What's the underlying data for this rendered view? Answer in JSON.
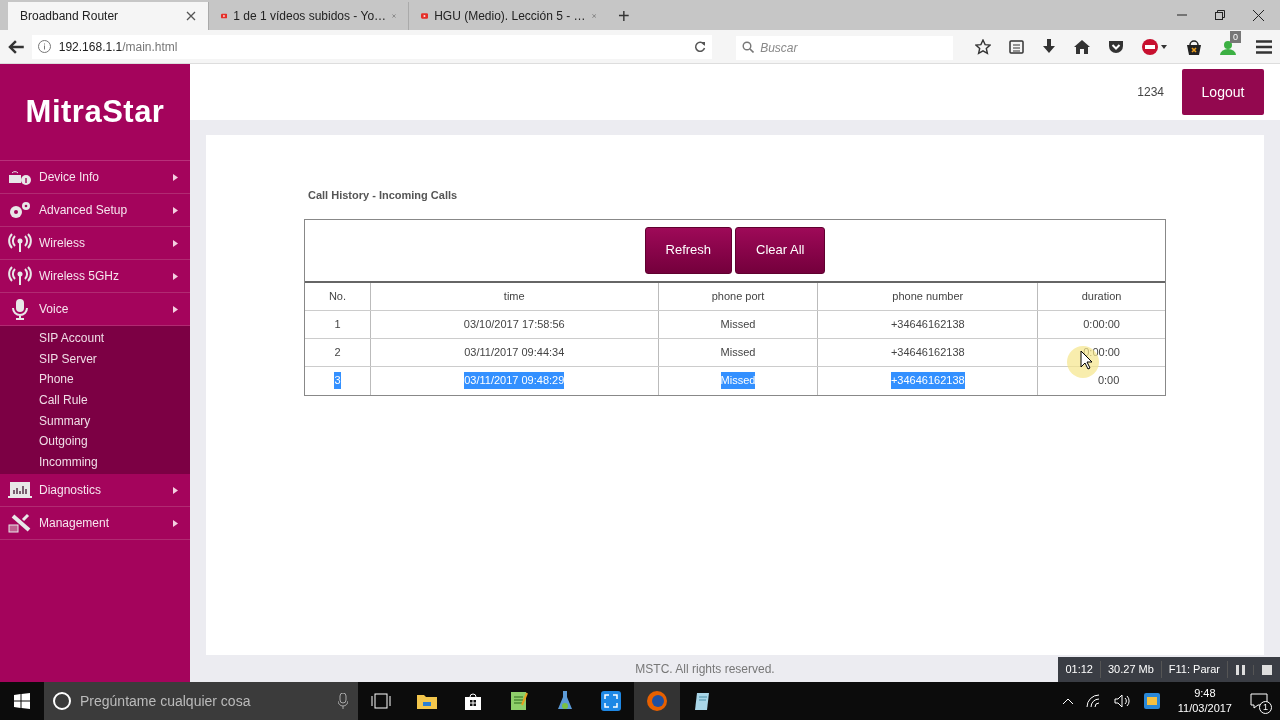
{
  "browser": {
    "tabs": [
      {
        "title": "Broadband Router",
        "selected": true,
        "kind": "page"
      },
      {
        "title": "1 de 1 vídeos subidos - Yo…",
        "selected": false,
        "kind": "video"
      },
      {
        "title": "HGU (Medio). Lección 5 - …",
        "selected": false,
        "kind": "video"
      }
    ],
    "new_tab": "+",
    "url_host": "192.168.1.1",
    "url_path": "/main.html",
    "search_placeholder": "Buscar",
    "notification_count": "0"
  },
  "header": {
    "logo": "MitraStar",
    "user": "1234",
    "logout": "Logout"
  },
  "sidebar": {
    "items": [
      {
        "label": "Device Info",
        "kind": "info"
      },
      {
        "label": "Advanced Setup",
        "kind": "gears"
      },
      {
        "label": "Wireless",
        "kind": "antenna"
      },
      {
        "label": "Wireless 5GHz",
        "kind": "antenna"
      },
      {
        "label": "Voice",
        "kind": "mic",
        "children": [
          {
            "label": "SIP Account"
          },
          {
            "label": "SIP Server"
          },
          {
            "label": "Phone"
          },
          {
            "label": "Call Rule"
          },
          {
            "label": "Summary"
          },
          {
            "label": "Outgoing"
          },
          {
            "label": "Incomming"
          }
        ]
      },
      {
        "label": "Diagnostics",
        "kind": "chart"
      },
      {
        "label": "Management",
        "kind": "tools"
      }
    ]
  },
  "content": {
    "title": "Call History - Incoming Calls",
    "buttons": [
      "Refresh",
      "Clear All"
    ],
    "table": {
      "columns": [
        "No.",
        "time",
        "phone port",
        "phone number",
        "duration"
      ],
      "rows": [
        {
          "cells": [
            {
              "text": "1",
              "highlighted": false
            },
            {
              "text": "03/10/2017 17:58:56",
              "highlighted": false
            },
            {
              "text": "Missed",
              "highlighted": false
            },
            {
              "text": "+34646162138",
              "highlighted": false
            },
            {
              "text": "0:00:00",
              "highlighted": false
            }
          ]
        },
        {
          "cells": [
            {
              "text": "2",
              "highlighted": false
            },
            {
              "text": "03/11/2017 09:44:34",
              "highlighted": false
            },
            {
              "text": "Missed",
              "highlighted": false
            },
            {
              "text": "+34646162138",
              "highlighted": false
            },
            {
              "text": "0:00:00",
              "highlighted": false
            }
          ]
        },
        {
          "cells": [
            {
              "text": "3",
              "highlighted": true
            },
            {
              "text": "03/11/2017 09:48:29",
              "highlighted": true
            },
            {
              "text": "Missed",
              "highlighted": true
            },
            {
              "text": "+34646162138",
              "highlighted": true
            },
            {
              "text": "0:00",
              "highlighted": false
            }
          ]
        }
      ]
    }
  },
  "footer": "MSTC. All rights reserved.",
  "recorder": {
    "elapsed": "01:12",
    "size": "30.27 Mb",
    "hotkey": "F11: Parar"
  },
  "taskbar": {
    "search_placeholder": "Pregúntame cualquier cosa",
    "time": "9:48",
    "date": "11/03/2017",
    "notifications": "1"
  }
}
